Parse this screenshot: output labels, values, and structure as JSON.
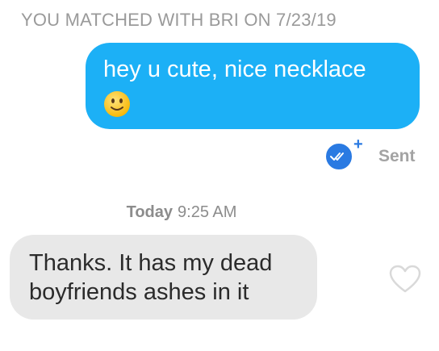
{
  "header": {
    "match_text": "YOU MATCHED WITH BRI ON 7/23/19"
  },
  "messages": {
    "outgoing": {
      "text": "hey u cute, nice necklace",
      "emoji_icon": "slightly-smiling-face-icon",
      "bubble_color": "#1cb0f6",
      "status": "Sent",
      "read_receipt_icon": "double-check-icon",
      "read_receipt_color": "#2a7ae2"
    },
    "timestamp": {
      "day": "Today",
      "time": "9:25 AM"
    },
    "incoming": {
      "text": "Thanks. It has my dead boyfriends ashes in it",
      "bubble_color": "#e8e8e8",
      "like_icon": "heart-outline-icon"
    }
  }
}
